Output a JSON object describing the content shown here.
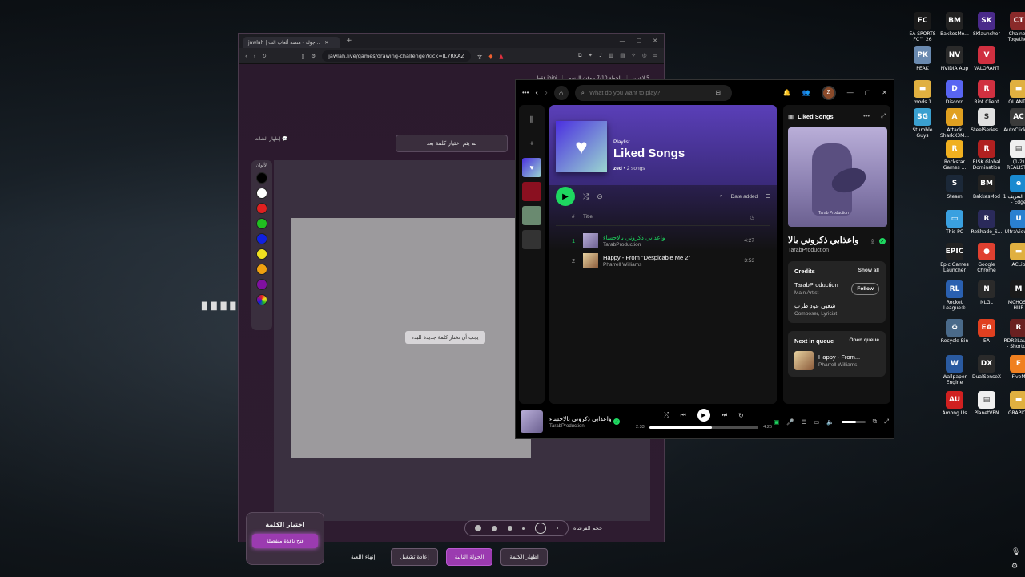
{
  "desktop": {
    "overlay_text": "█ █ █ █",
    "icons": [
      {
        "label": "EA SPORTS FC™ 26",
        "glyph": "FC",
        "color": "#1a1a1a"
      },
      {
        "label": "BakkesMo...",
        "glyph": "BM",
        "color": "#222222"
      },
      {
        "label": "SKlauncher",
        "glyph": "SK",
        "color": "#4a2a8a"
      },
      {
        "label": "Chained Together",
        "glyph": "CT",
        "color": "#8a2a2a"
      },
      {
        "label": "PEAK",
        "glyph": "PK",
        "color": "#6a8ab0"
      },
      {
        "label": "NVIDIA App",
        "glyph": "NV",
        "color": "#2a2a2a"
      },
      {
        "label": "VALORANT",
        "glyph": "V",
        "color": "#d03040"
      },
      {
        "label": "mods 1",
        "glyph": "▬",
        "color": "#e0b040"
      },
      {
        "label": "Discord",
        "glyph": "D",
        "color": "#5865f2"
      },
      {
        "label": "Riot Client",
        "glyph": "R",
        "color": "#d03040"
      },
      {
        "label": "QUANTV",
        "glyph": "▬",
        "color": "#e0b040"
      },
      {
        "label": "Stumble Guys",
        "glyph": "SG",
        "color": "#3aa0d0"
      },
      {
        "label": "Attack SharkX3M...",
        "glyph": "A",
        "color": "#e0a020"
      },
      {
        "label": "SteelSeries...",
        "glyph": "S",
        "color": "#e0e0e0"
      },
      {
        "label": "AutoClicke...",
        "glyph": "AC",
        "color": "#3a3a3a"
      },
      {
        "label": "Rockstar Games ...",
        "glyph": "R",
        "color": "#f0b020"
      },
      {
        "label": "RISK Global Domination",
        "glyph": "R",
        "color": "#b02020"
      },
      {
        "label": "(1-2) REALIST...",
        "glyph": "▤",
        "color": "#f0f0f0"
      },
      {
        "label": "Steam",
        "glyph": "S",
        "color": "#1b2838"
      },
      {
        "label": "BakkesMod",
        "glyph": "BM",
        "color": "#222222"
      },
      {
        "label": "ملف التعريف 1 - Edge",
        "glyph": "e",
        "color": "#1a8ad0"
      },
      {
        "label": "This PC",
        "glyph": "▭",
        "color": "#3aa0e0"
      },
      {
        "label": "ReShade_S...",
        "glyph": "R",
        "color": "#2a2a5a"
      },
      {
        "label": "UltraViewer",
        "glyph": "U",
        "color": "#2a80d0"
      },
      {
        "label": "Epic Games Launcher",
        "glyph": "EPIC",
        "color": "#222222"
      },
      {
        "label": "Google Chrome",
        "glyph": "●",
        "color": "#e04030"
      },
      {
        "label": "ACLib",
        "glyph": "▬",
        "color": "#e0b040"
      },
      {
        "label": "Rocket League®",
        "glyph": "RL",
        "color": "#2a60b0"
      },
      {
        "label": "NLGL",
        "glyph": "N",
        "color": "#2a2a2a"
      },
      {
        "label": "MCHOSE HUB",
        "glyph": "M",
        "color": "#1a1a1a"
      },
      {
        "label": "Recycle Bin",
        "glyph": "♻",
        "color": "#4a6a8a"
      },
      {
        "label": "EA",
        "glyph": "EA",
        "color": "#e04020"
      },
      {
        "label": "RDR2Laun... - Shortcut",
        "glyph": "R",
        "color": "#6a2020"
      },
      {
        "label": "Wallpaper Engine",
        "glyph": "W",
        "color": "#2a5aa0"
      },
      {
        "label": "DualSenseX",
        "glyph": "DX",
        "color": "#2a2a2a"
      },
      {
        "label": "FiveM",
        "glyph": "F",
        "color": "#f08020"
      },
      {
        "label": "Among Us",
        "glyph": "AU",
        "color": "#d02020"
      },
      {
        "label": "PlanetVPN",
        "glyph": "▤",
        "color": "#f0f0f0"
      },
      {
        "label": "GRAPICS",
        "glyph": "▬",
        "color": "#e0b040"
      }
    ]
  },
  "browser": {
    "tab_title": "jawlah | جولة - منصة ألعاب الث...",
    "url": "jawlah.live/games/drawing-challenge?kick=IL7RKAZ",
    "game": {
      "players": "5 لاعبين",
      "round": "الجولة 7/10 - وقت الرسم",
      "join": "joini فقط",
      "word_status": "لم يتم اختيار كلمة بعد",
      "chat_toggle": "إظهار الشات",
      "colors_title": "الألوان",
      "colors": [
        "#000000",
        "#ffffff",
        "#e02020",
        "#20c020",
        "#1020e0",
        "#f0e020",
        "#f0a010",
        "#8010a0"
      ],
      "need_word": "يجب أن تختار كلمة جديدة للبدء",
      "brush_label": "حجم الفرشاة",
      "choose_word_title": "اختيار الكلمة",
      "choose_word_button": "فتح نافذة منفصلة",
      "show_word": "اظهار الكلمة",
      "next_round": "الجولة التالية",
      "restart": "إعادة تشغيل",
      "end_game": "إنهاء اللعبة"
    }
  },
  "spotify": {
    "search_placeholder": "What do you want to play?",
    "avatar_initial": "Z",
    "playlist": {
      "type": "Playlist",
      "title": "Liked Songs",
      "owner": "zed",
      "count": "• 2 songs",
      "sort_label": "Date added",
      "col_num": "#",
      "col_title": "Title",
      "tracks": [
        {
          "num": "1",
          "title": "واعذابي ذكروني بالاحساء",
          "artist": "TarabProduction",
          "duration": "4:27"
        },
        {
          "num": "2",
          "title": "Happy - From \"Despicable Me 2\"",
          "artist": "Pharrell Williams",
          "duration": "3:53"
        }
      ]
    },
    "side": {
      "header": "Liked Songs",
      "art_caption": "Tarab Production",
      "track_title": "واعذابي ذكروني بالا",
      "track_artist": "TarabProduction",
      "credits_title": "Credits",
      "show_all": "Show all",
      "credit1_name": "TarabProduction",
      "credit1_role": "Main Artist",
      "follow": "Follow",
      "credit2_name": "شعبي عود طرب",
      "credit2_role": "Composer, Lyricist",
      "queue_title": "Next in queue",
      "open_queue": "Open queue",
      "queue_track": "Happy - From...",
      "queue_artist": "Pharrell Williams"
    },
    "now_playing": {
      "title": "واعذابي ذكروني بالاحساء",
      "artist": "TarabProduction",
      "elapsed": "2:33",
      "total": "4:26",
      "progress": 0.57,
      "volume": 0.6
    }
  }
}
